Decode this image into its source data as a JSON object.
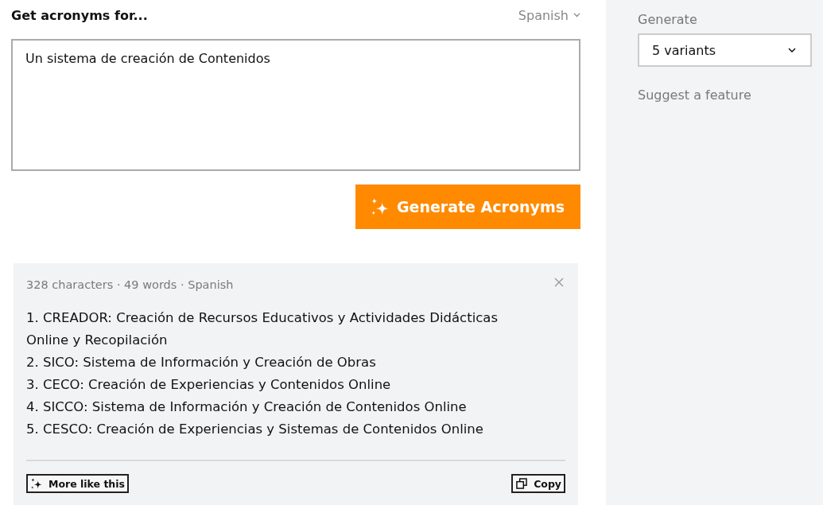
{
  "header": {
    "title": "Get acronyms for...",
    "language": "Spanish"
  },
  "input": {
    "value": "Un sistema de creación de Contenidos"
  },
  "generate_button": {
    "label": "Generate Acronyms"
  },
  "result": {
    "meta": "328 characters · 49 words · Spanish",
    "items": [
      "1. CREADOR: Creación de Recursos Educativos y Actividades Didácticas Online y Recopilación",
      "2. SICO: Sistema de Información y Creación de Obras",
      "3. CECO: Creación de Experiencias y Contenidos Online",
      "4. SICCO: Sistema de Información y Creación de Contenidos Online",
      "5. CESCO: Creación de Experiencias y Sistemas de Contenidos Online"
    ],
    "actions": [
      {
        "kind": "more",
        "label": "More like this"
      },
      {
        "kind": "copy",
        "label": "Copy"
      }
    ]
  },
  "sidebar": {
    "generate_label": "Generate",
    "variants": "5 variants",
    "suggest_link": "Suggest a feature"
  }
}
